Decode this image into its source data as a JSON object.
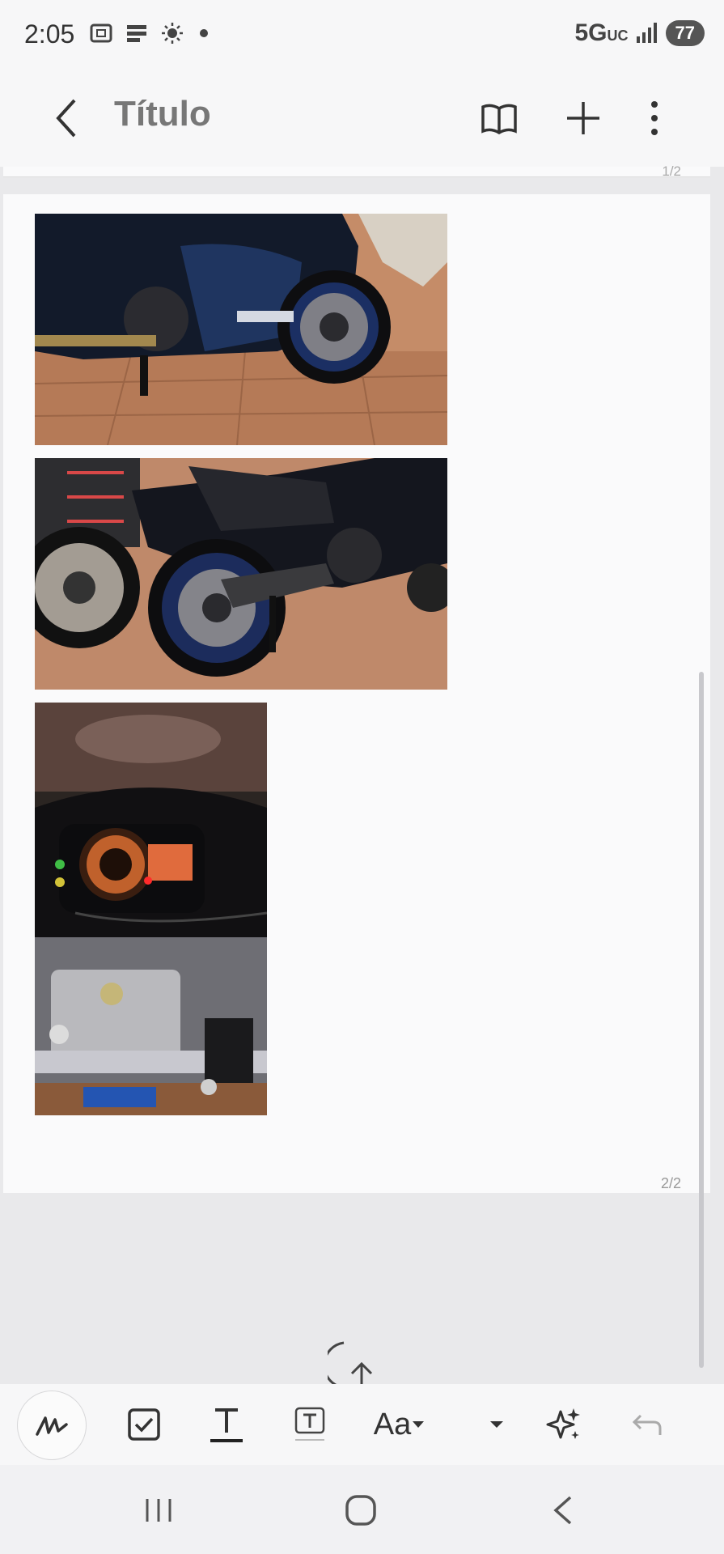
{
  "status_bar": {
    "time": "2:05",
    "network": "5G",
    "network_sub": "UC",
    "battery": "77",
    "icons": [
      "screenshot-icon",
      "flipboard-icon",
      "brightness-icon",
      "dot-icon",
      "signal-icon",
      "battery-icon"
    ]
  },
  "header": {
    "title": "Título",
    "actions": [
      "book-view-icon",
      "add-icon",
      "more-icon"
    ]
  },
  "document": {
    "page1_number": "1/2",
    "page2_number": "2/2",
    "images": [
      {
        "name": "motorcycle-front-photo",
        "subject": "blue Suzuki motorcycle front side"
      },
      {
        "name": "motorcycle-rear-photo",
        "subject": "motorcycle rear wheel and exhaust"
      },
      {
        "name": "motorcycle-dashboard-photo",
        "subject": "instrument cluster and handlebar"
      }
    ]
  },
  "toolbar": {
    "font_label": "Aa",
    "tools": [
      "pen-icon",
      "checkbox-icon",
      "text-icon",
      "textbox-icon",
      "font-icon",
      "dropdown-icon",
      "ai-sparkle-icon",
      "undo-icon"
    ]
  },
  "colors": {
    "background": "#e9e9eb",
    "page": "#fafafb",
    "bars": "#f7f7f8",
    "title": "#777777"
  }
}
